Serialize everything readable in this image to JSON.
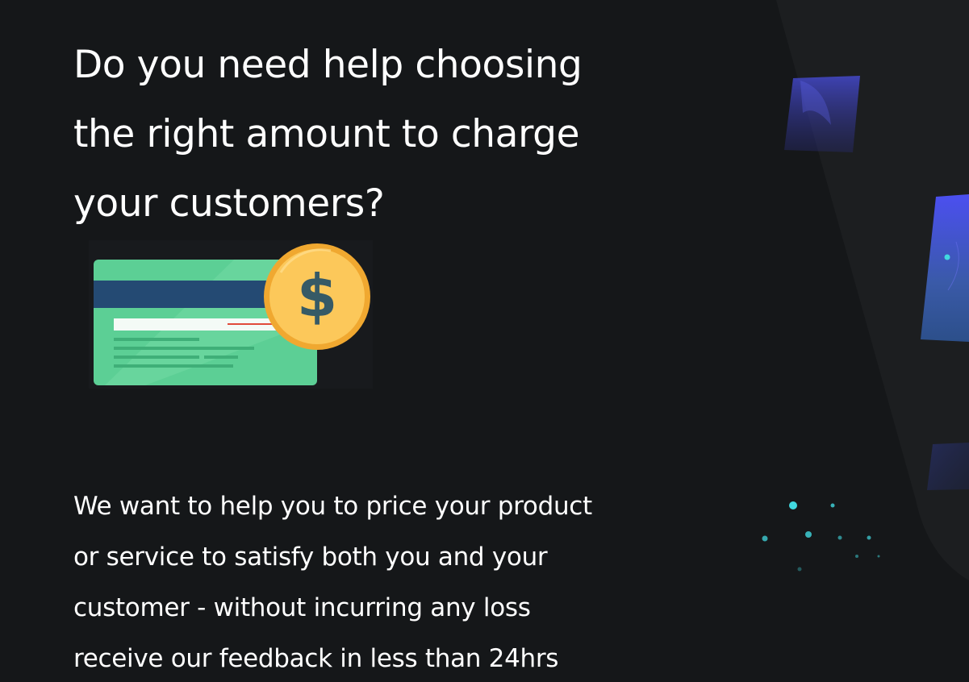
{
  "hero": {
    "headline_lines": [
      "Do you need help choosing",
      "the right amount to charge",
      "your customers?"
    ],
    "illustration": {
      "icon": "credit-card-with-dollar-coin-icon",
      "coin_symbol": "$"
    },
    "body_lines": [
      "We want to help you to price your product",
      "or service to satisfy both you and your",
      "customer - without incurring any loss",
      "receive our feedback in less than 24hrs"
    ]
  },
  "colors": {
    "background": "#151719",
    "panel": "#1c1e20",
    "text": "#ffffff",
    "card_green": "#5ccf95",
    "card_stripe": "#244a73",
    "coin_gold": "#f8b63e",
    "accent_blue": "#4a4fe3",
    "particle_cyan": "#41d9e0"
  }
}
